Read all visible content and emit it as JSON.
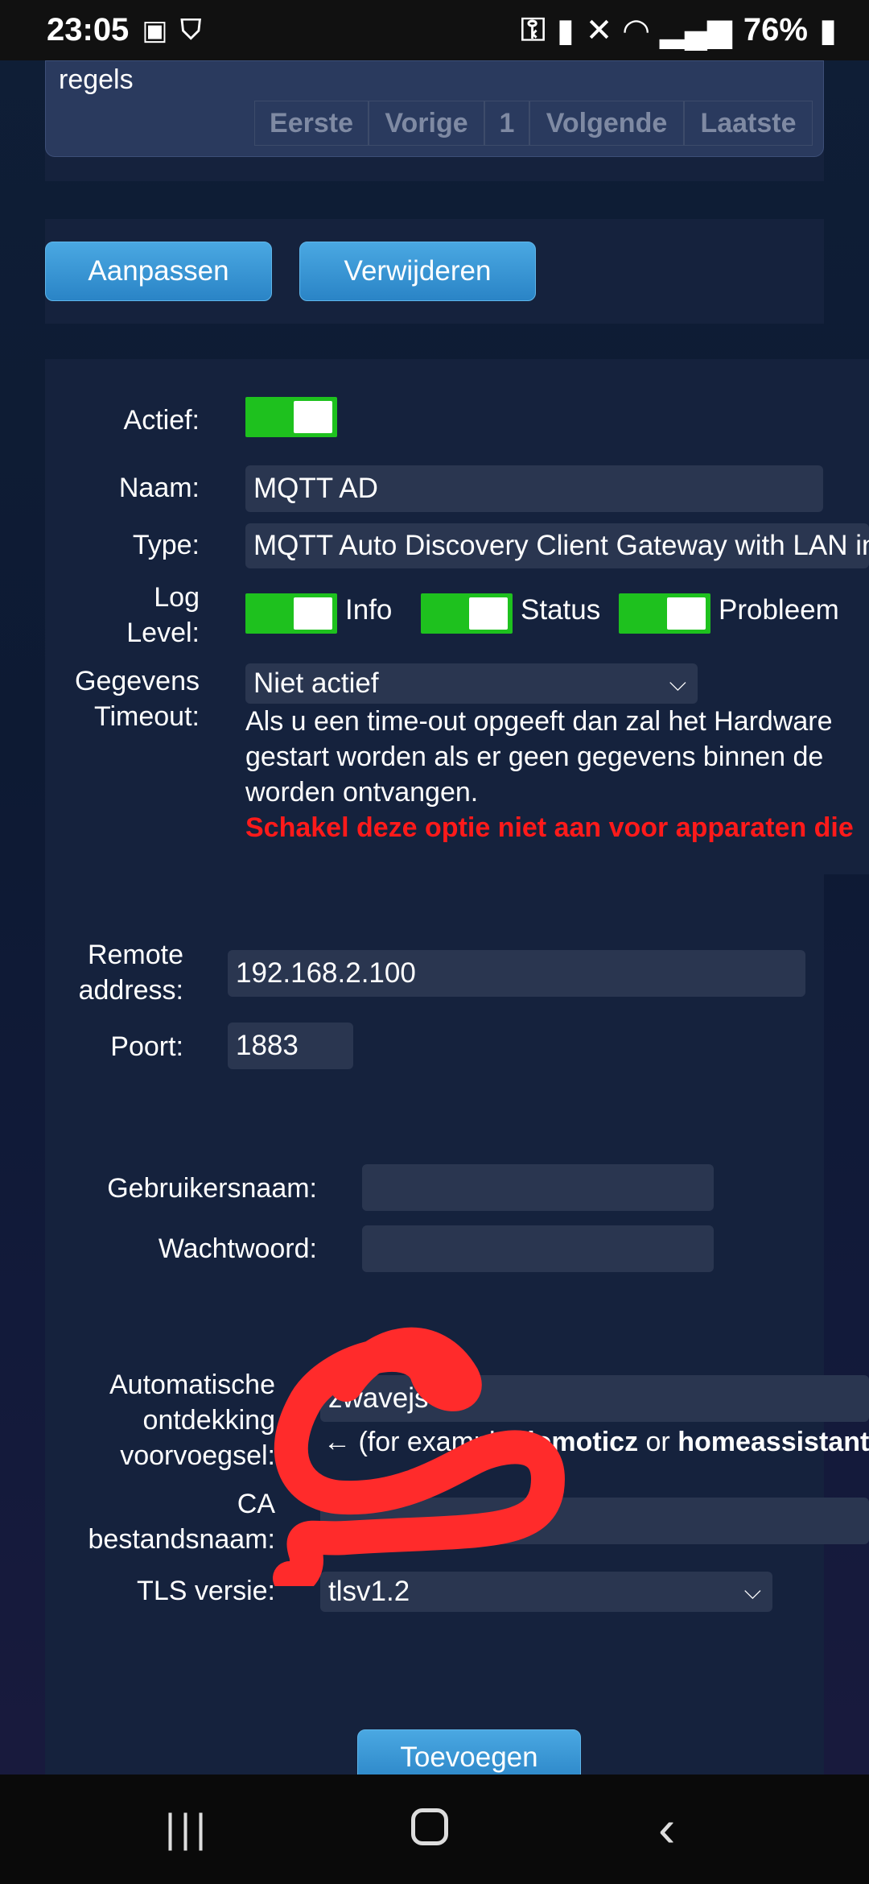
{
  "status_bar": {
    "time": "23:05",
    "battery": "76%"
  },
  "table_fragment": {
    "rows_label": "regels",
    "pager": [
      "Eerste",
      "Vorige",
      "1",
      "Volgende",
      "Laatste"
    ]
  },
  "actions": {
    "edit": "Aanpassen",
    "delete": "Verwijderen"
  },
  "form": {
    "active_label": "Actief:",
    "name_label": "Naam:",
    "name_value": "MQTT AD",
    "type_label": "Type:",
    "type_value": "MQTT Auto Discovery Client Gateway with LAN interface",
    "loglevel_label_1": "Log",
    "loglevel_label_2": "Level:",
    "loglevel_info": "Info",
    "loglevel_status": "Status",
    "loglevel_error": "Probleem",
    "timeout_label_1": "Gegevens",
    "timeout_label_2": "Timeout:",
    "timeout_value": "Niet actief",
    "timeout_help_1": "Als u een time-out opgeeft dan zal het Hardware",
    "timeout_help_2": "gestart worden als er geen gegevens binnen de",
    "timeout_help_3": "worden ontvangen.",
    "timeout_warning": "Schakel deze optie niet aan voor apparaten die",
    "remote_label_1": "Remote",
    "remote_label_2": "address:",
    "remote_value": "192.168.2.100",
    "port_label": "Poort:",
    "port_value": "1883",
    "username_label": "Gebruikersnaam:",
    "username_value": "",
    "password_label": "Wachtwoord:",
    "password_value": "",
    "prefix_label_1": "Automatische",
    "prefix_label_2": "ontdekking",
    "prefix_label_3": "voorvoegsel:",
    "prefix_value": "zwavejs",
    "prefix_hint_pre": "← (for example ",
    "prefix_hint_b1": "domoticz",
    "prefix_hint_mid": " or ",
    "prefix_hint_b2": "homeassistant",
    "ca_label_1": "CA",
    "ca_label_2": "bestandsnaam:",
    "ca_value": "",
    "tls_label": "TLS versie:",
    "tls_value": "tlsv1.2",
    "add_button": "Toevoegen"
  },
  "colors": {
    "toggle_on": "#1ec11e",
    "button": "#2a84c6",
    "warning": "#ff1a1a",
    "annotation": "#ff2b2b"
  }
}
